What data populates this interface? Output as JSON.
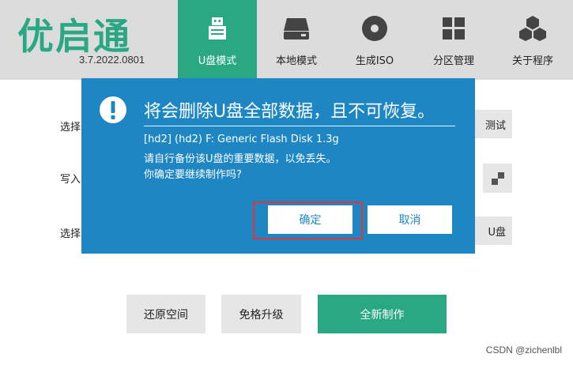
{
  "app": {
    "logo_text": "优启通",
    "version": "3.7.2022.0801"
  },
  "tabs": [
    {
      "label": "U盘模式",
      "icon": "usb-drive-icon",
      "active": true
    },
    {
      "label": "本地模式",
      "icon": "hard-disk-icon",
      "active": false
    },
    {
      "label": "生成ISO",
      "icon": "disc-icon",
      "active": false
    },
    {
      "label": "分区管理",
      "icon": "partition-grid-icon",
      "active": false
    },
    {
      "label": "关于程序",
      "icon": "cubes-icon",
      "active": false
    }
  ],
  "form": {
    "row1_label": "选择",
    "row2_label": "写入",
    "row3_label": "选择",
    "side_button_1": "测试",
    "side_button_3": "U盘"
  },
  "bottom_buttons": {
    "restore": "还原空间",
    "upgrade": "免格升级",
    "create": "全新制作"
  },
  "modal": {
    "title": "将会删除U盘全部数据，且不可恢复。",
    "device_line": "[hd2] (hd2) F: Generic Flash Disk 1.3g",
    "backup_line": "请自行备份该U盘的重要数据，以免丢失。",
    "confirm_line": "你确定要继续制作吗?",
    "ok_label": "确定",
    "cancel_label": "取消"
  },
  "colors": {
    "brand_green": "#2aa884",
    "modal_blue": "#1e87c3",
    "highlight_red": "#e63333"
  },
  "watermark": "CSDN @zichenlbl"
}
